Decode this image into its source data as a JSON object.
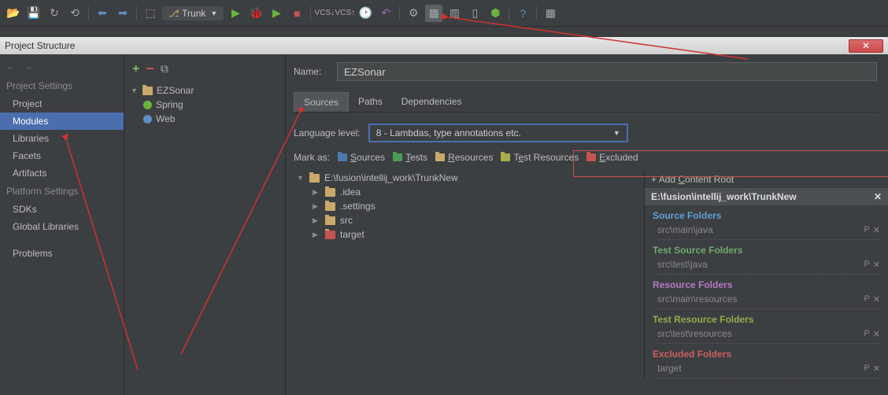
{
  "toolbar": {
    "branch": "Trunk"
  },
  "window": {
    "title": "Project Structure"
  },
  "sidebar": {
    "heading1": "Project Settings",
    "items1": [
      "Project",
      "Modules",
      "Libraries",
      "Facets",
      "Artifacts"
    ],
    "heading2": "Platform Settings",
    "items2": [
      "SDKs",
      "Global Libraries"
    ],
    "problems": "Problems"
  },
  "midtree": {
    "root": "EZSonar",
    "children": [
      "Spring",
      "Web"
    ]
  },
  "main": {
    "name_label": "Name:",
    "name_value": "EZSonar",
    "tabs": [
      "Sources",
      "Paths",
      "Dependencies"
    ],
    "lang_label": "Language level:",
    "lang_value": "8 - Lambdas, type annotations etc.",
    "mark_label": "Mark as:",
    "marks": {
      "sources": "Sources",
      "tests": "Tests",
      "resources": "Resources",
      "test_resources": "Test Resources",
      "excluded": "Excluded"
    },
    "dirs": {
      "root": "E:\\fusion\\intellij_work\\TrunkNew",
      "children": [
        ".idea",
        ".settings",
        "src",
        "target"
      ]
    }
  },
  "content_root": {
    "add": "Add Content Root",
    "path": "E:\\fusion\\intellij_work\\TrunkNew",
    "sections": [
      {
        "title": "Source Folders",
        "class": "c-src",
        "items": [
          "src\\main\\java"
        ]
      },
      {
        "title": "Test Source Folders",
        "class": "c-tst",
        "items": [
          "src\\test\\java"
        ]
      },
      {
        "title": "Resource Folders",
        "class": "c-res",
        "items": [
          "src\\main\\resources"
        ]
      },
      {
        "title": "Test Resource Folders",
        "class": "c-tres",
        "items": [
          "src\\test\\resources"
        ]
      },
      {
        "title": "Excluded Folders",
        "class": "c-exc",
        "items": [
          "target"
        ]
      }
    ]
  }
}
